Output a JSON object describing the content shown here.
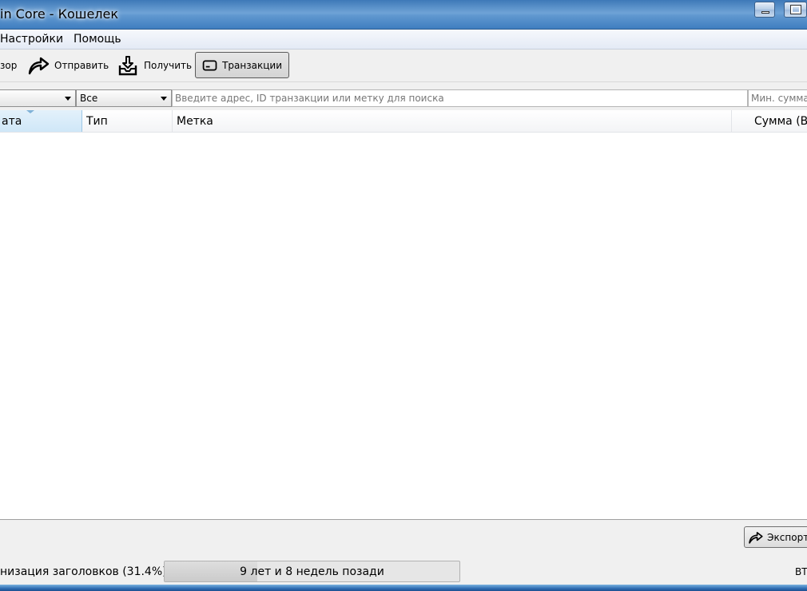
{
  "window": {
    "title": "in Core - Кошелек"
  },
  "menu": {
    "items": [
      "Настройки",
      "Помощь"
    ]
  },
  "toolbar": {
    "overview_label": "зор",
    "send_label": "Отправить",
    "receive_label": "Получить",
    "transactions_label": "Транзакции"
  },
  "filters": {
    "date_combo_value": "",
    "type_combo_value": "Все",
    "search_placeholder": "Введите адрес, ID транзакции или метку для поиска",
    "min_amount_placeholder": "Мин. сумма"
  },
  "table": {
    "columns": [
      "ата",
      "Тип",
      "Метка",
      "Сумма (BT"
    ],
    "rows": []
  },
  "footer": {
    "export_label": "Экспорти"
  },
  "status": {
    "sync_text": "низация заголовков (31.4%)...",
    "progress_label": "9 лет и 8 недель позади",
    "progress_fraction": 0.314,
    "unit": "BT"
  }
}
